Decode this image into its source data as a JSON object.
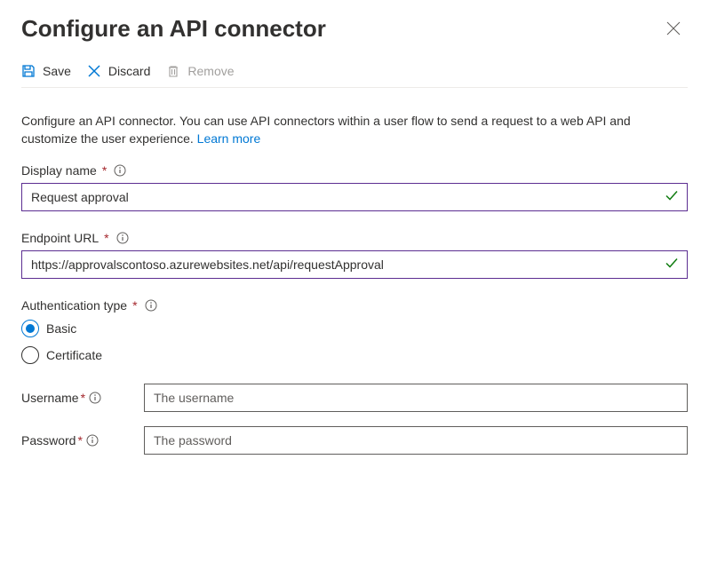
{
  "header": {
    "title": "Configure an API connector"
  },
  "toolbar": {
    "save": "Save",
    "discard": "Discard",
    "remove": "Remove"
  },
  "description": {
    "text": "Configure an API connector. You can use API connectors within a user flow to send a request to a web API and customize the user experience.",
    "learn_more": "Learn more"
  },
  "fields": {
    "display_name": {
      "label": "Display name",
      "value": "Request approval"
    },
    "endpoint_url": {
      "label": "Endpoint URL",
      "value": "https://approvalscontoso.azurewebsites.net/api/requestApproval"
    },
    "auth_type": {
      "label": "Authentication type",
      "options": {
        "basic": "Basic",
        "certificate": "Certificate"
      },
      "selected": "basic"
    },
    "username": {
      "label": "Username",
      "placeholder": "The username"
    },
    "password": {
      "label": "Password",
      "placeholder": "The password"
    }
  }
}
